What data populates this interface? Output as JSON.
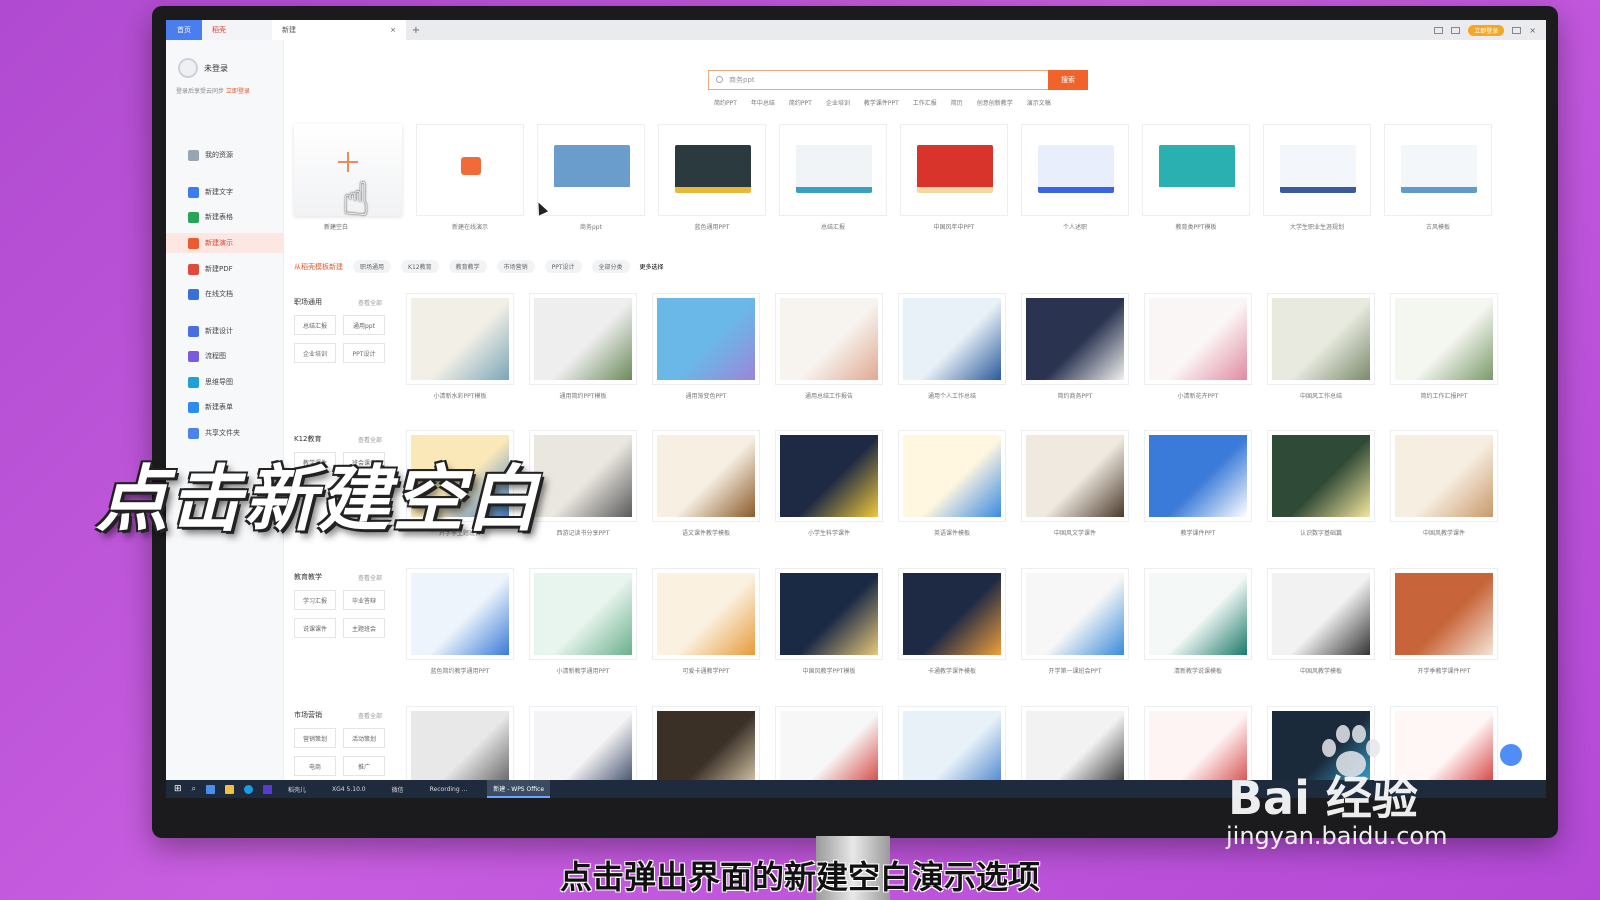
{
  "tabs": {
    "home": "首页",
    "wps": "稻壳",
    "active": "新建",
    "close": "×",
    "add": "+",
    "login": "立即登录"
  },
  "sidebar": {
    "user_name": "未登录",
    "login_tip": "登录后享受云同步",
    "login_link": "立即登录",
    "items": [
      {
        "label": "我的资源",
        "color": "#9aa4b2"
      },
      {
        "label": "新建文字",
        "color": "#3d7cf0"
      },
      {
        "label": "新建表格",
        "color": "#24a55a"
      },
      {
        "label": "新建演示",
        "color": "#ec5a2f"
      },
      {
        "label": "新建PDF",
        "color": "#e14a3b"
      },
      {
        "label": "在线文档",
        "color": "#3a6fd8"
      },
      {
        "label": "新建设计",
        "color": "#4a6fe0"
      },
      {
        "label": "流程图",
        "color": "#7a5ae0"
      },
      {
        "label": "思维导图",
        "color": "#1ea1d8"
      },
      {
        "label": "新建表单",
        "color": "#2d8cf0"
      },
      {
        "label": "共享文件夹",
        "color": "#4b84e8"
      }
    ]
  },
  "search": {
    "placeholder": "商务ppt",
    "button": "搜索",
    "hot_tags": [
      "简约PPT",
      "年中总结",
      "简约PPT",
      "企业培训",
      "教学课件PPT",
      "工作汇报",
      "简历",
      "创意创新教学",
      "演示文稿"
    ]
  },
  "top_row": {
    "blank_label": "新建空白",
    "templates": [
      {
        "label": "新建在线演示",
        "color": "#ffffff",
        "accent": "#f06a3a"
      },
      {
        "label": "商务ppt",
        "color": "#6a9ccc",
        "accent": "#ffffff"
      },
      {
        "label": "蓝色通用PPT",
        "color": "#2b3a3e",
        "accent": "#e8b83a"
      },
      {
        "label": "总结汇报",
        "color": "#f0f4f6",
        "accent": "#3aa0c0"
      },
      {
        "label": "中国风年中PPT",
        "color": "#d9342c",
        "accent": "#f5d7a0"
      },
      {
        "label": "个人述职",
        "color": "#e8eefb",
        "accent": "#3a64e0"
      },
      {
        "label": "教育类PPT模板",
        "color": "#2ab0b0",
        "accent": "#ffffff"
      },
      {
        "label": "大学生职业生涯规划",
        "color": "#f3f6fa",
        "accent": "#3a5a9a"
      },
      {
        "label": "古风模板",
        "color": "#f4f7fa",
        "accent": "#5f9cc8"
      }
    ]
  },
  "filters": {
    "title": "从稻壳模板新建",
    "chips": [
      "职场通用",
      "K12教育",
      "教育教学",
      "市场营销",
      "PPT设计",
      "全部分类"
    ],
    "extra": "更多选择"
  },
  "sections": [
    {
      "title": "职场通用",
      "more": "查看全部",
      "chips": [
        "总结汇报",
        "通用ppt",
        "企业培训",
        "PPT设计"
      ],
      "cards": [
        {
          "label": "小清新水彩PPT模板",
          "bg": "#f2efe6",
          "accent": "#7aa6b8"
        },
        {
          "label": "通用简约PPT模板",
          "bg": "#eeeeee",
          "accent": "#6a8a5a"
        },
        {
          "label": "通用渐变色PPT",
          "bg": "#6ab8e8",
          "accent": "#9a86d8"
        },
        {
          "label": "通用总结工作报告",
          "bg": "#f7f4f0",
          "accent": "#e0a890"
        },
        {
          "label": "通用个人工作总结",
          "bg": "#e8f0f8",
          "accent": "#2a5a9a"
        },
        {
          "label": "简约商务PPT",
          "bg": "#2a3450",
          "accent": "#f0f0f0"
        },
        {
          "label": "小清新花卉PPT",
          "bg": "#fbf6f6",
          "accent": "#e08aa0"
        },
        {
          "label": "中国风工作总结",
          "bg": "#e8eae0",
          "accent": "#7a8a6a"
        },
        {
          "label": "简约工作汇报PPT",
          "bg": "#f4f6f0",
          "accent": "#7a9a6a"
        }
      ]
    },
    {
      "title": "K12教育",
      "more": "查看全部",
      "chips": [
        "教学课件",
        "班会课件"
      ],
      "cards": [
        {
          "label": "开学季主题班会",
          "bg": "#fbe8b8",
          "accent": "#3a7ac8"
        },
        {
          "label": "西游记读书分享PPT",
          "bg": "#eae6e0",
          "accent": "#5a5a5a"
        },
        {
          "label": "语文课件教学模板",
          "bg": "#f6efe2",
          "accent": "#8a5a2a"
        },
        {
          "label": "小学生科学课件",
          "bg": "#1e2a44",
          "accent": "#f0c83a"
        },
        {
          "label": "英语课件模板",
          "bg": "#fff7e0",
          "accent": "#3a8ae0"
        },
        {
          "label": "中国风文学课件",
          "bg": "#efe9df",
          "accent": "#4a3a2a"
        },
        {
          "label": "教学课件PPT",
          "bg": "#3a7ad8",
          "accent": "#ffffff"
        },
        {
          "label": "认识数字基础篇",
          "bg": "#2f4a36",
          "accent": "#f5e6a0"
        },
        {
          "label": "中国风教学课件",
          "bg": "#f7eee2",
          "accent": "#c89a6a"
        }
      ]
    },
    {
      "title": "教育教学",
      "more": "查看全部",
      "chips": [
        "学习汇报",
        "毕业答辩",
        "说课课件",
        "主题班会"
      ],
      "cards": [
        {
          "label": "蓝色简约教学通用PPT",
          "bg": "#eef4fb",
          "accent": "#3a7ad8"
        },
        {
          "label": "小清新教学通用PPT",
          "bg": "#e8f4ee",
          "accent": "#6ab08a"
        },
        {
          "label": "可爱卡通教学PPT",
          "bg": "#fbf1e0",
          "accent": "#e89a3a"
        },
        {
          "label": "中国风教学PPT模板",
          "bg": "#1a2a44",
          "accent": "#e8c87a"
        },
        {
          "label": "卡通教学课件模板",
          "bg": "#1e2a44",
          "accent": "#f0a03a"
        },
        {
          "label": "开学第一课班会PPT",
          "bg": "#f7f7f7",
          "accent": "#3a8ad8"
        },
        {
          "label": "清新教学说课模板",
          "bg": "#f4f8f6",
          "accent": "#1a7a6a"
        },
        {
          "label": "中国风教学模板",
          "bg": "#f2f2f2",
          "accent": "#333333"
        },
        {
          "label": "开学季教学课件PPT",
          "bg": "#c8643a",
          "accent": "#f4e6d8"
        }
      ]
    },
    {
      "title": "市场营销",
      "more": "查看全部",
      "chips": [
        "营销策划",
        "活动策划",
        "电商",
        "推广"
      ],
      "cards": [
        {
          "label": "商务营销PPT",
          "bg": "#e8e8e8",
          "accent": "#555555"
        },
        {
          "label": "商务策划方案",
          "bg": "#f4f4f6",
          "accent": "#2a3a5a"
        },
        {
          "label": "语言艺术魅力演讲",
          "bg": "#3a3026",
          "accent": "#e8d8b8"
        },
        {
          "label": "运动健身策划",
          "bg": "#f7f7f7",
          "accent": "#d0302a"
        },
        {
          "label": "商务策划方案",
          "bg": "#e8f0f8",
          "accent": "#3a7ac8"
        },
        {
          "label": "摄影社招新",
          "bg": "#f2f2f2",
          "accent": "#222222"
        },
        {
          "label": "品牌推广策划方案",
          "bg": "#fff4f4",
          "accent": "#d03a3a"
        },
        {
          "label": "营销策划执行方案",
          "bg": "#1a2a3a",
          "accent": "#3ab0e0"
        },
        {
          "label": "营销活动策划方案",
          "bg": "#fff6f6",
          "accent": "#d02a2a"
        }
      ]
    }
  ],
  "taskbar": {
    "items": [
      "稻壳儿",
      "XG4 5.10.0",
      "微信",
      "Recording ...",
      "新建 - WPS Office"
    ]
  },
  "overlay": {
    "big_caption": "点击新建空白",
    "subtitle": "点击弹出界面的新建空白演示选项",
    "watermark": "Bai 经验",
    "watermark_url": "jingyan.baidu.com"
  }
}
